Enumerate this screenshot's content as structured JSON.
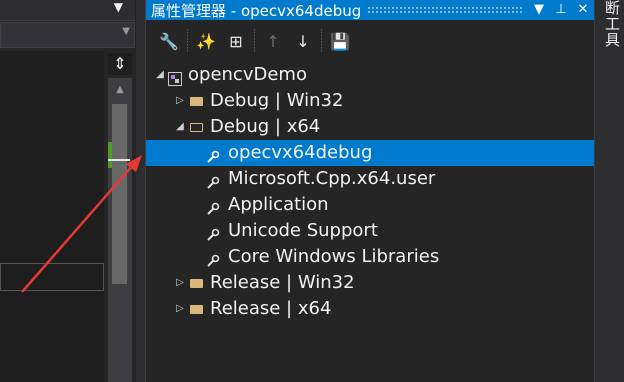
{
  "left_pane": {
    "top_dropdown_glyph": "▼",
    "dropdown_glyph": "▼",
    "split_glyph": "⇕",
    "scroll_up_glyph": "▲"
  },
  "panel": {
    "title": "属性管理器 - opecvx64debug",
    "title_buttons": [
      "▼",
      "⊥",
      "✕"
    ],
    "accent": "#007acc",
    "toolbar": [
      {
        "icon": "wrench-icon",
        "glyph": "🔧",
        "enabled": true
      },
      {
        "icon": "add-new-property-sheet-icon",
        "glyph": "✨",
        "enabled": true
      },
      {
        "icon": "add-existing-property-sheet-icon",
        "glyph": "⊞",
        "enabled": true
      },
      {
        "icon": "move-up-icon",
        "glyph": "↑",
        "enabled": false
      },
      {
        "icon": "move-down-icon",
        "glyph": "↓",
        "enabled": true
      },
      {
        "icon": "save-icon",
        "glyph": "💾",
        "enabled": true
      }
    ],
    "tree": {
      "project": {
        "label": "opencvDemo",
        "expanded": true
      },
      "configs": [
        {
          "label": "Debug | Win32",
          "expanded": false
        },
        {
          "label": "Debug | x64",
          "expanded": true,
          "children": [
            {
              "label": "opecvx64debug",
              "selected": true
            },
            {
              "label": "Microsoft.Cpp.x64.user"
            },
            {
              "label": "Application"
            },
            {
              "label": "Unicode Support"
            },
            {
              "label": "Core Windows Libraries"
            }
          ]
        },
        {
          "label": "Release | Win32",
          "expanded": false
        },
        {
          "label": "Release | x64",
          "expanded": false
        }
      ]
    }
  },
  "right_strip": {
    "label": "断工具"
  }
}
